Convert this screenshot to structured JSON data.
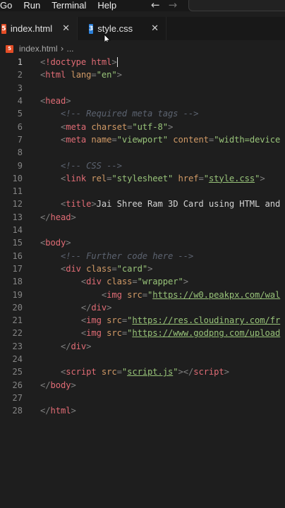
{
  "menubar": {
    "items": [
      "Go",
      "Run",
      "Terminal",
      "Help"
    ],
    "back_glyph": "←",
    "forward_glyph": "→"
  },
  "tabs": [
    {
      "label": "index.html",
      "icon": "html5-icon",
      "close": "✕"
    },
    {
      "label": "style.css",
      "icon": "css3-icon",
      "close": "✕"
    }
  ],
  "breadcrumb": {
    "file": "index.html",
    "separator": "›",
    "trail": "..."
  },
  "editor": {
    "current_line": 1,
    "lines": [
      {
        "n": "1",
        "tokens": [
          [
            "t-punc",
            "<"
          ],
          [
            "t-tag",
            "!doctype html"
          ],
          [
            "t-punc",
            ">"
          ],
          [
            "cursor",
            ""
          ]
        ]
      },
      {
        "n": "2",
        "tokens": [
          [
            "t-punc",
            "<"
          ],
          [
            "t-tag",
            "html"
          ],
          [
            "t-text",
            " "
          ],
          [
            "t-attr",
            "lang"
          ],
          [
            "t-punc",
            "="
          ],
          [
            "t-str",
            "\"en\""
          ],
          [
            "t-punc",
            ">"
          ]
        ]
      },
      {
        "n": "3",
        "tokens": []
      },
      {
        "n": "4",
        "tokens": [
          [
            "t-punc",
            "<"
          ],
          [
            "t-tag",
            "head"
          ],
          [
            "t-punc",
            ">"
          ]
        ]
      },
      {
        "n": "5",
        "tokens": [
          [
            "t-text",
            "    "
          ],
          [
            "t-comment",
            "<!-- Required meta tags -->"
          ]
        ]
      },
      {
        "n": "6",
        "tokens": [
          [
            "t-text",
            "    "
          ],
          [
            "t-punc",
            "<"
          ],
          [
            "t-tag",
            "meta"
          ],
          [
            "t-text",
            " "
          ],
          [
            "t-attr",
            "charset"
          ],
          [
            "t-punc",
            "="
          ],
          [
            "t-str",
            "\"utf-8\""
          ],
          [
            "t-punc",
            ">"
          ]
        ]
      },
      {
        "n": "7",
        "tokens": [
          [
            "t-text",
            "    "
          ],
          [
            "t-punc",
            "<"
          ],
          [
            "t-tag",
            "meta"
          ],
          [
            "t-text",
            " "
          ],
          [
            "t-attr",
            "name"
          ],
          [
            "t-punc",
            "="
          ],
          [
            "t-str",
            "\"viewport\""
          ],
          [
            "t-text",
            " "
          ],
          [
            "t-attr",
            "content"
          ],
          [
            "t-punc",
            "="
          ],
          [
            "t-str",
            "\"width=device"
          ]
        ]
      },
      {
        "n": "8",
        "tokens": []
      },
      {
        "n": "9",
        "tokens": [
          [
            "t-text",
            "    "
          ],
          [
            "t-comment",
            "<!-- CSS -->"
          ]
        ]
      },
      {
        "n": "10",
        "tokens": [
          [
            "t-text",
            "    "
          ],
          [
            "t-punc",
            "<"
          ],
          [
            "t-tag",
            "link"
          ],
          [
            "t-text",
            " "
          ],
          [
            "t-attr",
            "rel"
          ],
          [
            "t-punc",
            "="
          ],
          [
            "t-str",
            "\"stylesheet\""
          ],
          [
            "t-text",
            " "
          ],
          [
            "t-attr",
            "href"
          ],
          [
            "t-punc",
            "="
          ],
          [
            "t-str",
            "\""
          ],
          [
            "t-link",
            "style.css"
          ],
          [
            "t-str",
            "\""
          ],
          [
            "t-punc",
            ">"
          ]
        ]
      },
      {
        "n": "11",
        "tokens": []
      },
      {
        "n": "12",
        "tokens": [
          [
            "t-text",
            "    "
          ],
          [
            "t-punc",
            "<"
          ],
          [
            "t-tag",
            "title"
          ],
          [
            "t-punc",
            ">"
          ],
          [
            "t-text",
            "Jai Shree Ram 3D Card using HTML and"
          ]
        ]
      },
      {
        "n": "13",
        "tokens": [
          [
            "t-punc",
            "</"
          ],
          [
            "t-tag",
            "head"
          ],
          [
            "t-punc",
            ">"
          ]
        ]
      },
      {
        "n": "14",
        "tokens": []
      },
      {
        "n": "15",
        "tokens": [
          [
            "t-punc",
            "<"
          ],
          [
            "t-tag",
            "body"
          ],
          [
            "t-punc",
            ">"
          ]
        ]
      },
      {
        "n": "16",
        "tokens": [
          [
            "t-text",
            "    "
          ],
          [
            "t-comment",
            "<!-- Further code here -->"
          ]
        ]
      },
      {
        "n": "17",
        "tokens": [
          [
            "t-text",
            "    "
          ],
          [
            "t-punc",
            "<"
          ],
          [
            "t-tag",
            "div"
          ],
          [
            "t-text",
            " "
          ],
          [
            "t-attr",
            "class"
          ],
          [
            "t-punc",
            "="
          ],
          [
            "t-str",
            "\"card\""
          ],
          [
            "t-punc",
            ">"
          ]
        ]
      },
      {
        "n": "18",
        "tokens": [
          [
            "t-text",
            "        "
          ],
          [
            "t-punc",
            "<"
          ],
          [
            "t-tag",
            "div"
          ],
          [
            "t-text",
            " "
          ],
          [
            "t-attr",
            "class"
          ],
          [
            "t-punc",
            "="
          ],
          [
            "t-str",
            "\"wrapper\""
          ],
          [
            "t-punc",
            ">"
          ]
        ]
      },
      {
        "n": "19",
        "tokens": [
          [
            "t-text",
            "            "
          ],
          [
            "t-punc",
            "<"
          ],
          [
            "t-tag",
            "img"
          ],
          [
            "t-text",
            " "
          ],
          [
            "t-attr",
            "src"
          ],
          [
            "t-punc",
            "="
          ],
          [
            "t-str",
            "\""
          ],
          [
            "t-link",
            "https://w0.peakpx.com/wal"
          ]
        ]
      },
      {
        "n": "20",
        "tokens": [
          [
            "t-text",
            "        "
          ],
          [
            "t-punc",
            "</"
          ],
          [
            "t-tag",
            "div"
          ],
          [
            "t-punc",
            ">"
          ]
        ]
      },
      {
        "n": "21",
        "tokens": [
          [
            "t-text",
            "        "
          ],
          [
            "t-punc",
            "<"
          ],
          [
            "t-tag",
            "img"
          ],
          [
            "t-text",
            " "
          ],
          [
            "t-attr",
            "src"
          ],
          [
            "t-punc",
            "="
          ],
          [
            "t-str",
            "\""
          ],
          [
            "t-link",
            "https://res.cloudinary.com/fr"
          ]
        ]
      },
      {
        "n": "22",
        "tokens": [
          [
            "t-text",
            "        "
          ],
          [
            "t-punc",
            "<"
          ],
          [
            "t-tag",
            "img"
          ],
          [
            "t-text",
            " "
          ],
          [
            "t-attr",
            "src"
          ],
          [
            "t-punc",
            "="
          ],
          [
            "t-str",
            "\""
          ],
          [
            "t-link",
            "https://www.godpng.com/upload"
          ]
        ]
      },
      {
        "n": "23",
        "tokens": [
          [
            "t-text",
            "    "
          ],
          [
            "t-punc",
            "</"
          ],
          [
            "t-tag",
            "div"
          ],
          [
            "t-punc",
            ">"
          ]
        ]
      },
      {
        "n": "24",
        "tokens": []
      },
      {
        "n": "25",
        "tokens": [
          [
            "t-text",
            "    "
          ],
          [
            "t-punc",
            "<"
          ],
          [
            "t-tag",
            "script"
          ],
          [
            "t-text",
            " "
          ],
          [
            "t-attr",
            "src"
          ],
          [
            "t-punc",
            "="
          ],
          [
            "t-str",
            "\""
          ],
          [
            "t-link",
            "script.js"
          ],
          [
            "t-str",
            "\""
          ],
          [
            "t-punc",
            "></"
          ],
          [
            "t-tag",
            "script"
          ],
          [
            "t-punc",
            ">"
          ]
        ]
      },
      {
        "n": "26",
        "tokens": [
          [
            "t-punc",
            "</"
          ],
          [
            "t-tag",
            "body"
          ],
          [
            "t-punc",
            ">"
          ]
        ]
      },
      {
        "n": "27",
        "tokens": []
      },
      {
        "n": "28",
        "tokens": [
          [
            "t-punc",
            "</"
          ],
          [
            "t-tag",
            "html"
          ],
          [
            "t-punc",
            ">"
          ]
        ]
      }
    ]
  },
  "colors": {
    "background": "#1e1e1e",
    "tag": "#e06c75",
    "attribute": "#d19a66",
    "string": "#98c379",
    "comment": "#5c6370"
  }
}
